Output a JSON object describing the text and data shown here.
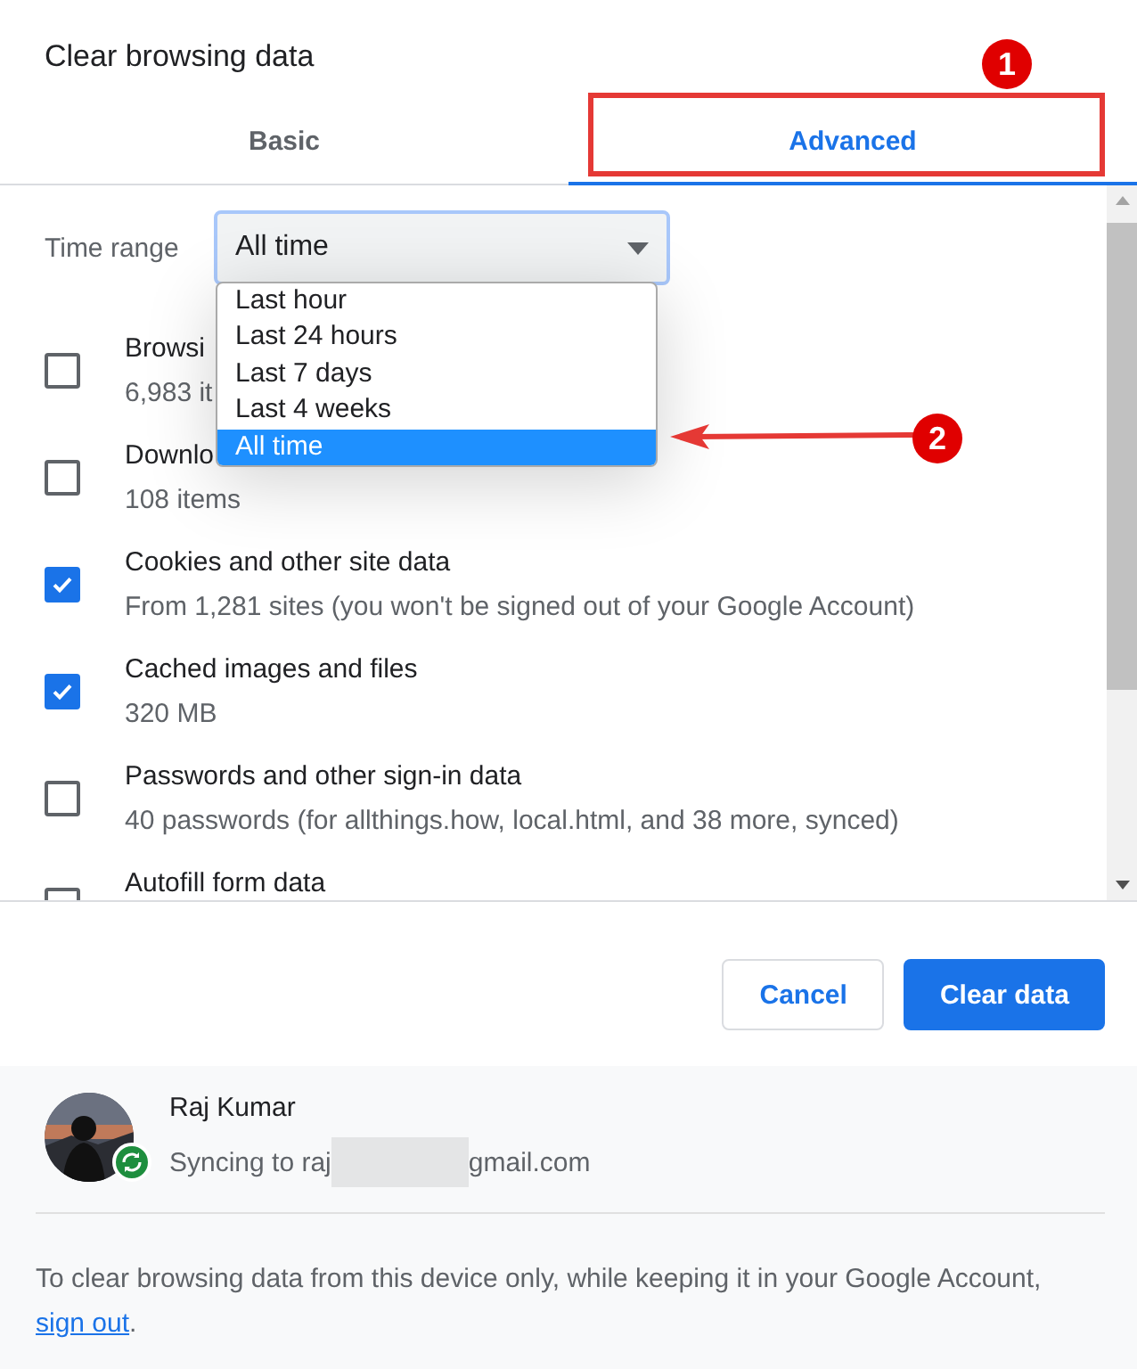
{
  "dialog": {
    "title": "Clear browsing data"
  },
  "tabs": [
    {
      "label": "Basic",
      "selected": false
    },
    {
      "label": "Advanced",
      "selected": true
    }
  ],
  "time_range": {
    "label": "Time range",
    "value": "All time"
  },
  "time_range_options": [
    {
      "label": "Last hour",
      "selected": false
    },
    {
      "label": "Last 24 hours",
      "selected": false
    },
    {
      "label": "Last 7 days",
      "selected": false
    },
    {
      "label": "Last 4 weeks",
      "selected": false
    },
    {
      "label": "All time",
      "selected": true
    }
  ],
  "items": [
    {
      "title": "Browsi",
      "detail": "6,983 it",
      "checked": false
    },
    {
      "title": "Downlo",
      "detail": "108 items",
      "checked": false
    },
    {
      "title": "Cookies and other site data",
      "detail": "From 1,281 sites (you won't be signed out of your Google Account)",
      "checked": true
    },
    {
      "title": "Cached images and files",
      "detail": "320 MB",
      "checked": true
    },
    {
      "title": "Passwords and other sign-in data",
      "detail": "40 passwords (for allthings.how, local.html, and 38 more, synced)",
      "checked": false
    },
    {
      "title": "Autofill form data",
      "checked": false
    }
  ],
  "buttons": [
    {
      "label": "Cancel",
      "kind": "secondary"
    },
    {
      "label": "Clear data",
      "kind": "primary"
    }
  ],
  "account": {
    "name": "Raj Kumar",
    "sync_prefix": "Syncing to raj",
    "sync_suffix": "gmail.com"
  },
  "note": {
    "text": "To clear browsing data from this device only, while keeping it in your Google Account,",
    "link": "sign out",
    "end": "."
  },
  "annotations": [
    {
      "number": "1"
    },
    {
      "number": "2"
    }
  ]
}
